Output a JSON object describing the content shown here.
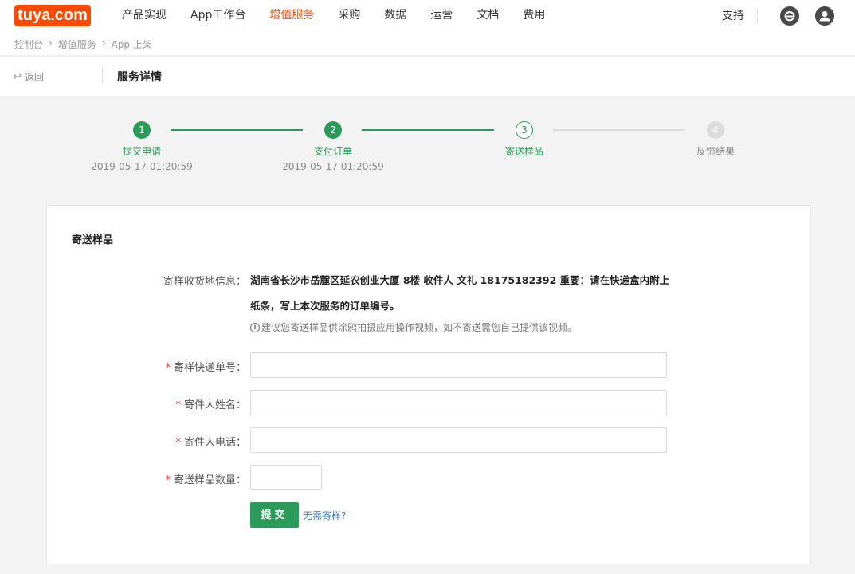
{
  "brand": {
    "logo_text": "tuya.com",
    "accent": "#ff4800",
    "success": "#2b9a5a"
  },
  "nav": {
    "items": [
      {
        "label": "产品实现"
      },
      {
        "label": "App工作台"
      },
      {
        "label": "增值服务"
      },
      {
        "label": "采购"
      },
      {
        "label": "数据"
      },
      {
        "label": "运营"
      },
      {
        "label": "文档"
      },
      {
        "label": "费用"
      }
    ],
    "active": "增值服务",
    "support_label": "支持",
    "icons": [
      "browser-icon",
      "user-avatar-icon"
    ]
  },
  "breadcrumb": [
    "控制台",
    "增值服务",
    "App 上架"
  ],
  "subheader": {
    "back_label": "返回",
    "title": "服务详情"
  },
  "steps": [
    {
      "num": "1",
      "title": "提交申请",
      "time": "2019-05-17 01:20:59",
      "status": "done"
    },
    {
      "num": "2",
      "title": "支付订单",
      "time": "2019-05-17 01:20:59",
      "status": "done"
    },
    {
      "num": "3",
      "title": "寄送样品",
      "time": "",
      "status": "current"
    },
    {
      "num": "4",
      "title": "反馈结果",
      "time": "",
      "status": "todo"
    }
  ],
  "form": {
    "title": "寄送样品",
    "address_label": "寄样收货地信息：",
    "address_text": "湖南省长沙市岳麓区延农创业大厦 8楼 收件人 文礼 18175182392  重要：请在快递盒内附上纸条，写上本次服务的订单编号。",
    "hint_icon": "info-icon",
    "hint_text": "建议您寄送样品供涂鸦拍摄应用操作视频，如不寄送需您自己提供该视频。",
    "required_mark": "*",
    "fields": {
      "tracking_label": "寄样快递单号：",
      "tracking_value": "",
      "name_label": "寄件人姓名：",
      "name_value": "",
      "phone_label": "寄件人电话：",
      "phone_value": "",
      "quantity_label": "寄送样品数量：",
      "quantity_value": ""
    },
    "submit_label": "提交",
    "no_sample_link": "无需寄样?"
  }
}
